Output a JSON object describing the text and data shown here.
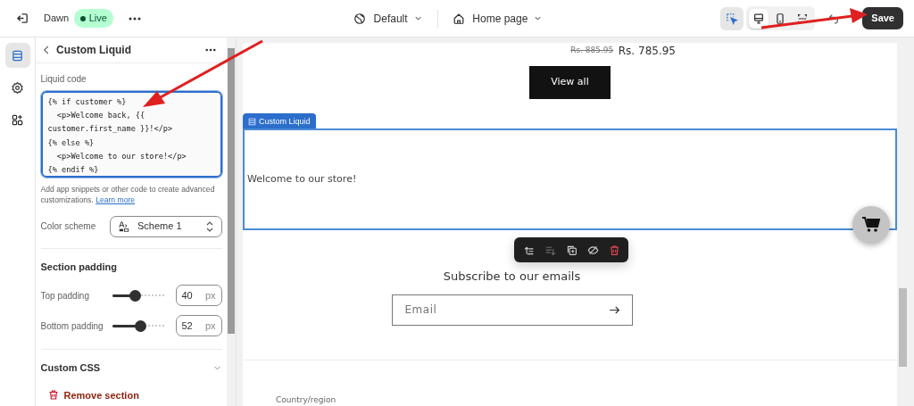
{
  "topbar": {
    "theme": "Dawn",
    "status": "Live",
    "theme_selector": "Default",
    "page_selector": "Home page",
    "inspector_on": true,
    "view_modes": [
      {
        "selected": true
      },
      {
        "selected": false
      },
      {
        "selected": false
      }
    ],
    "save": "Save"
  },
  "rail": [
    {
      "selected": true
    },
    {
      "selected": false
    },
    {
      "selected": false
    }
  ],
  "panel": {
    "title": "Custom Liquid",
    "field_label": "Liquid code",
    "code": "{% if customer %}\n  <p>Welcome back, {{ customer.first_name }}!</p>\n{% else %}\n  <p>Welcome to our store!</p>\n{% endif %}",
    "help": "Add app snippets or other code to create advanced customizations.",
    "help_link": "Learn more",
    "color_scheme": {
      "label": "Color scheme",
      "value": "Scheme 1"
    },
    "section_title": "Section padding",
    "sliders": [
      {
        "label": "Top padding",
        "level": 0.42,
        "value": "40",
        "unit": "px"
      },
      {
        "label": "Bottom padding",
        "level": 0.53,
        "value": "52",
        "unit": "px"
      }
    ],
    "custom_css": {
      "label": "Custom CSS",
      "expanded": false
    },
    "remove": "Remove section"
  },
  "preview": {
    "old_price": "Rs. 885.95",
    "price": "Rs. 785.95",
    "view_all": "View all",
    "section_tag": "Custom Liquid",
    "welcome": "Welcome to our store!",
    "toolbar": [
      {
        "disabled": false
      },
      {
        "disabled": true
      },
      {
        "disabled": false
      },
      {
        "disabled": false
      },
      {
        "disabled": false
      }
    ],
    "subscribe": "Subscribe to our emails",
    "email_placeholder": "Email",
    "country": "Country/region"
  }
}
